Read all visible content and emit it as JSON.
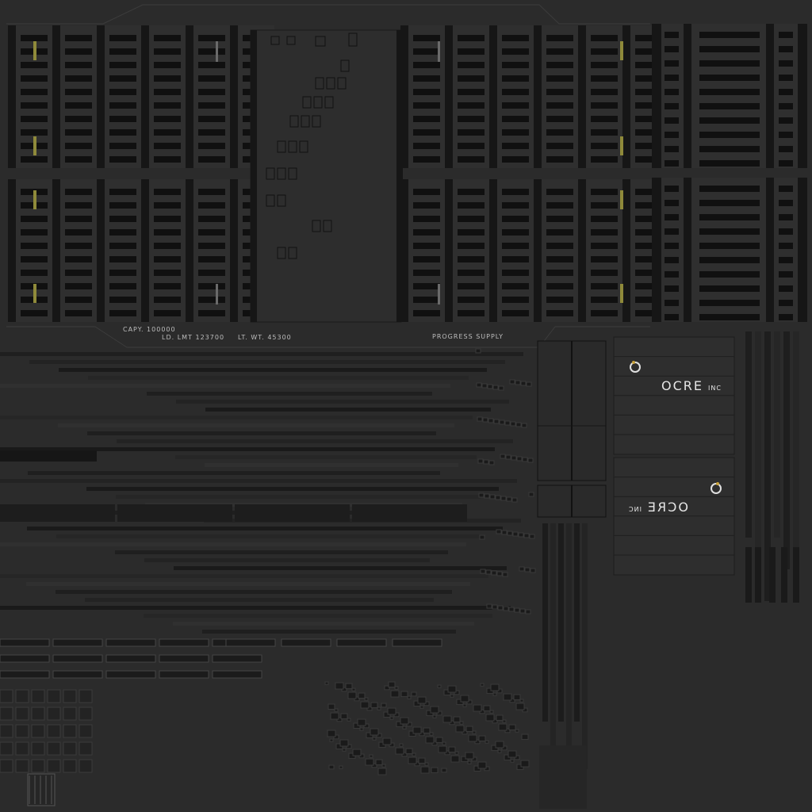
{
  "texture": {
    "stencil": {
      "capacity": "CAPY. 100000",
      "load_limit": "LD. LMT 123700",
      "light_weight": "LT. WT. 45300",
      "supplier": "PROGRESS SUPPLY"
    },
    "brand": {
      "name": "OCRE",
      "suffix": "INC",
      "logo_icon": "ocre-ring-logo-icon"
    },
    "colors": {
      "background": "#2b2b2b",
      "panel": "#2f2f2f",
      "slot": "#101010",
      "rib": "#161616",
      "accent_yellow": "#8f8a3a",
      "stencil_text": "#bdbdbd",
      "brand_text": "#e6e6e6"
    }
  }
}
